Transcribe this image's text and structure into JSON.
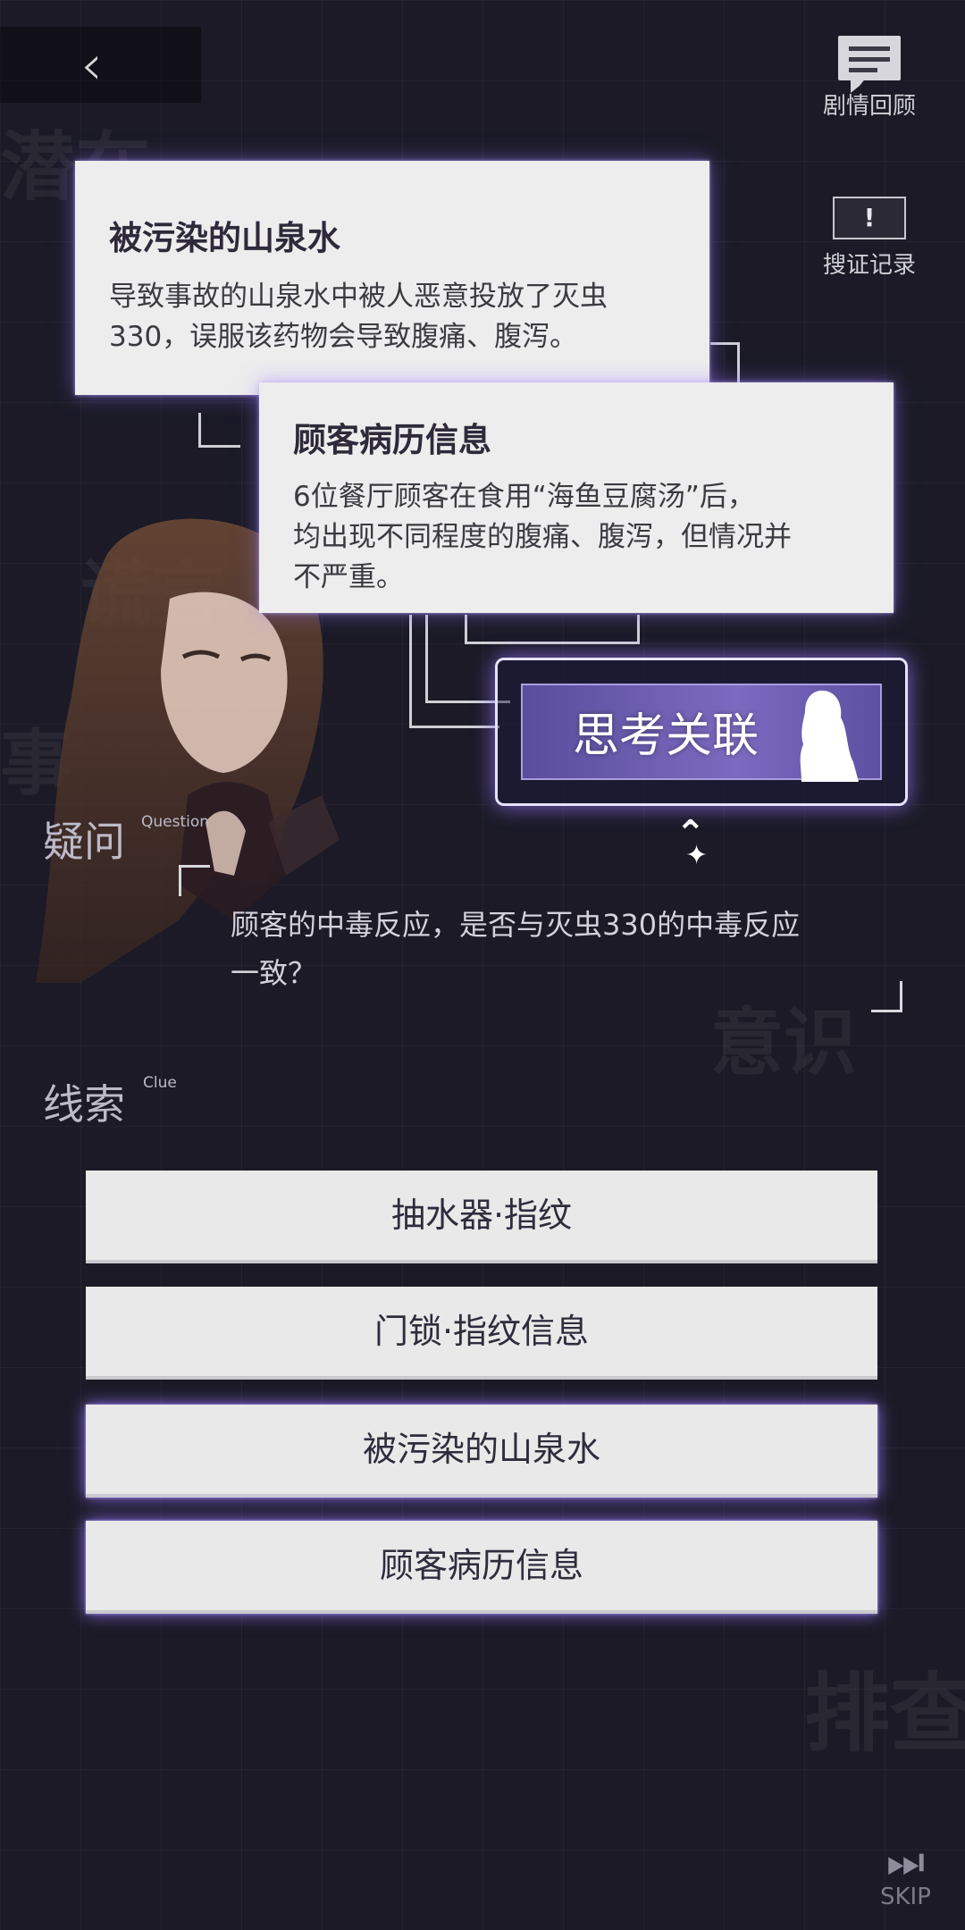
{
  "header": {
    "back_icon": "chevron-left-icon",
    "story_review_label": "剧情回顾",
    "evidence_log_label": "搜证记录",
    "evidence_log_mark": "!"
  },
  "background_words": [
    "潜在",
    "谎言",
    "事",
    "意识",
    "排查"
  ],
  "cards": [
    {
      "title": "被污染的山泉水",
      "lines": [
        "导致事故的山泉水中被人恶意投放了灭虫",
        "330，误服该药物会导致腹痛、腹泻。"
      ]
    },
    {
      "title": "顾客病历信息",
      "lines": [
        "6位餐厅顾客在食用“海鱼豆腐汤”后，",
        "均出现不同程度的腹痛、腹泻，但情况并",
        "不严重。"
      ]
    }
  ],
  "think_button": {
    "label": "思考关联",
    "figure_icon": "girl-silhouette-icon"
  },
  "question": {
    "title": "疑问",
    "sup": "Question",
    "lines": [
      "顾客的中毒反应，是否与灭虫330的中毒反应",
      "一致？"
    ]
  },
  "clues": {
    "title": "线索",
    "sup": "Clue",
    "items": [
      {
        "label": "抽水器·指纹",
        "highlighted": false
      },
      {
        "label": "门锁·指纹信息",
        "highlighted": false
      },
      {
        "label": "被污染的山泉水",
        "highlighted": true
      },
      {
        "label": "顾客病历信息",
        "highlighted": false
      }
    ]
  },
  "skip": {
    "label": "SKIP",
    "icon": "skip-forward-icon"
  },
  "colors": {
    "glow": "#9a7dff",
    "card_bg": "#ededed",
    "button_purple": "#6f5fb5",
    "bg": "#1b1a26"
  }
}
